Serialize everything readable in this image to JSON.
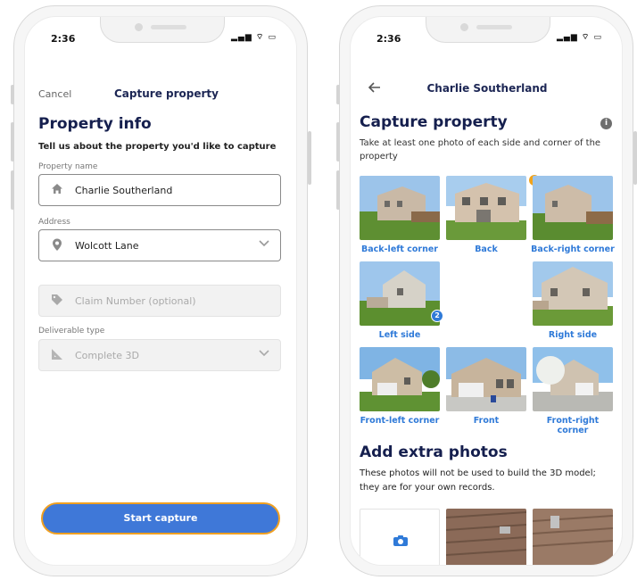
{
  "status": {
    "time": "2:36",
    "icons": "▂▄▆ ⌔ ▭"
  },
  "left": {
    "nav": {
      "cancel": "Cancel",
      "title": "Capture property"
    },
    "heading": "Property info",
    "subheading": "Tell us about the property you'd like to capture",
    "fields": {
      "name_label": "Property name",
      "name_value": "Charlie Southerland",
      "address_label": "Address",
      "address_value": "Wolcott Lane",
      "claim_placeholder": "Claim Number (optional)",
      "deliverable_label": "Deliverable type",
      "deliverable_value": "Complete 3D"
    },
    "start_button": "Start capture"
  },
  "right": {
    "nav_title": "Charlie Southerland",
    "heading": "Capture property",
    "info_icon": "i",
    "description": "Take at least one photo of each side and corner of the property",
    "tiles": {
      "back_left": "Back-left corner",
      "back": "Back",
      "back_right": "Back-right corner",
      "left_side": "Left side",
      "right_side": "Right side",
      "front_left": "Front-left corner",
      "front": "Front",
      "front_right": "Front-right corner"
    },
    "warn_badge": "!",
    "left_side_count": "2",
    "extra_heading": "Add extra photos",
    "extra_description": "These photos will not be used to build the 3D model; they are for your own records."
  },
  "colors": {
    "accent": "#2f7ad8",
    "button": "#3f78d8",
    "button_border": "#f0a021",
    "heading": "#151f4e",
    "warning": "#f2a31a"
  },
  "icons": [
    "home-icon",
    "location-pin-icon",
    "tag-icon",
    "ruler-icon",
    "chevron-down-icon",
    "back-arrow-icon",
    "info-icon",
    "camera-icon"
  ]
}
